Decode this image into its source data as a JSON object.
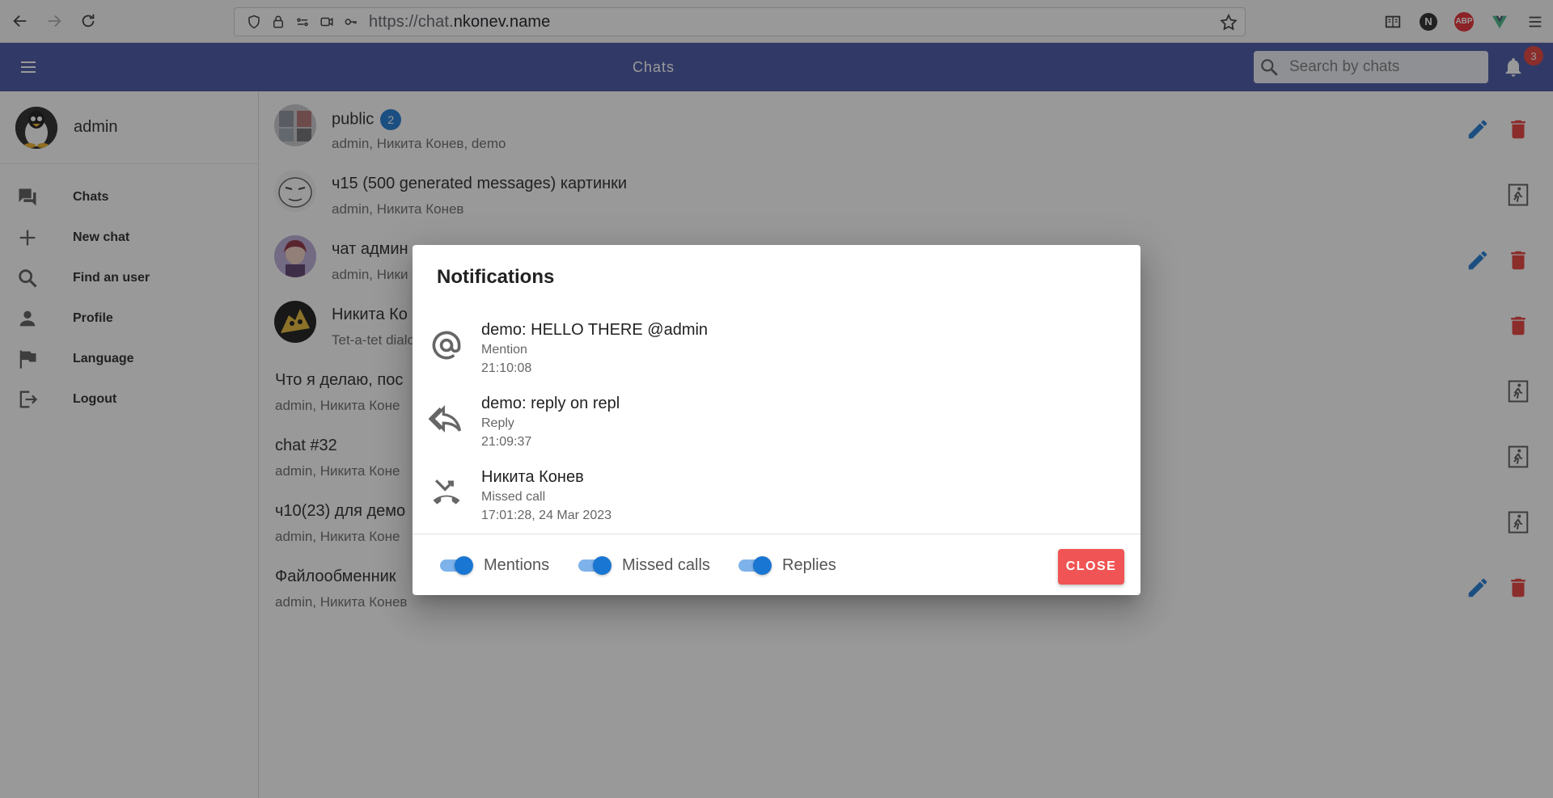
{
  "browser": {
    "url_prefix": "https://chat.",
    "url_domain": "nkonev.name",
    "ext_n_label": "N",
    "ext_abp_label": "ABP"
  },
  "appbar": {
    "title": "Chats",
    "search_placeholder": "Search by chats",
    "notification_count": "3"
  },
  "sidebar": {
    "user_name": "admin",
    "items": [
      {
        "label": "Chats",
        "icon": "chat-bubbles-icon"
      },
      {
        "label": "New chat",
        "icon": "plus-icon"
      },
      {
        "label": "Find an user",
        "icon": "search-icon"
      },
      {
        "label": "Profile",
        "icon": "person-icon"
      },
      {
        "label": "Language",
        "icon": "flag-icon"
      },
      {
        "label": "Logout",
        "icon": "logout-icon"
      }
    ]
  },
  "chats": [
    {
      "name": "public",
      "participants": "admin, Никита Конев, demo",
      "unread": "2"
    },
    {
      "name": "ч15 (500 generated messages) картинки",
      "participants": "admin, Никита Конев"
    },
    {
      "name": "чат админ",
      "participants": "admin, Ники"
    },
    {
      "name": "Никита Ко",
      "participants": "Tet-a-tet dialo"
    },
    {
      "name": "Что я делаю, пос",
      "participants": "admin, Никита Коне"
    },
    {
      "name": "chat #32",
      "participants": "admin, Никита Коне"
    },
    {
      "name": "ч10(23) для демо",
      "participants": "admin, Никита Коне"
    },
    {
      "name": "Файлообменник",
      "participants": "admin, Никита Конев"
    }
  ],
  "dialog": {
    "title": "Notifications",
    "notifications": [
      {
        "title": "demo: HELLO THERE @admin",
        "type": "Mention",
        "time": "21:10:08",
        "icon": "at-sign-icon"
      },
      {
        "title": "demo: reply on repl",
        "type": "Reply",
        "time": "21:09:37",
        "icon": "reply-icon"
      },
      {
        "title": "Никита Конев",
        "type": "Missed call",
        "time": "17:01:28, 24 Mar 2023",
        "icon": "missed-call-icon"
      }
    ],
    "toggles": [
      {
        "label": "Mentions",
        "on": true
      },
      {
        "label": "Missed calls",
        "on": true
      },
      {
        "label": "Replies",
        "on": true
      }
    ],
    "close_label": "CLOSE"
  },
  "colors": {
    "appbar": "#3f51a1",
    "accent": "#1976d2",
    "danger": "#e53935",
    "close_button": "#f05454"
  }
}
